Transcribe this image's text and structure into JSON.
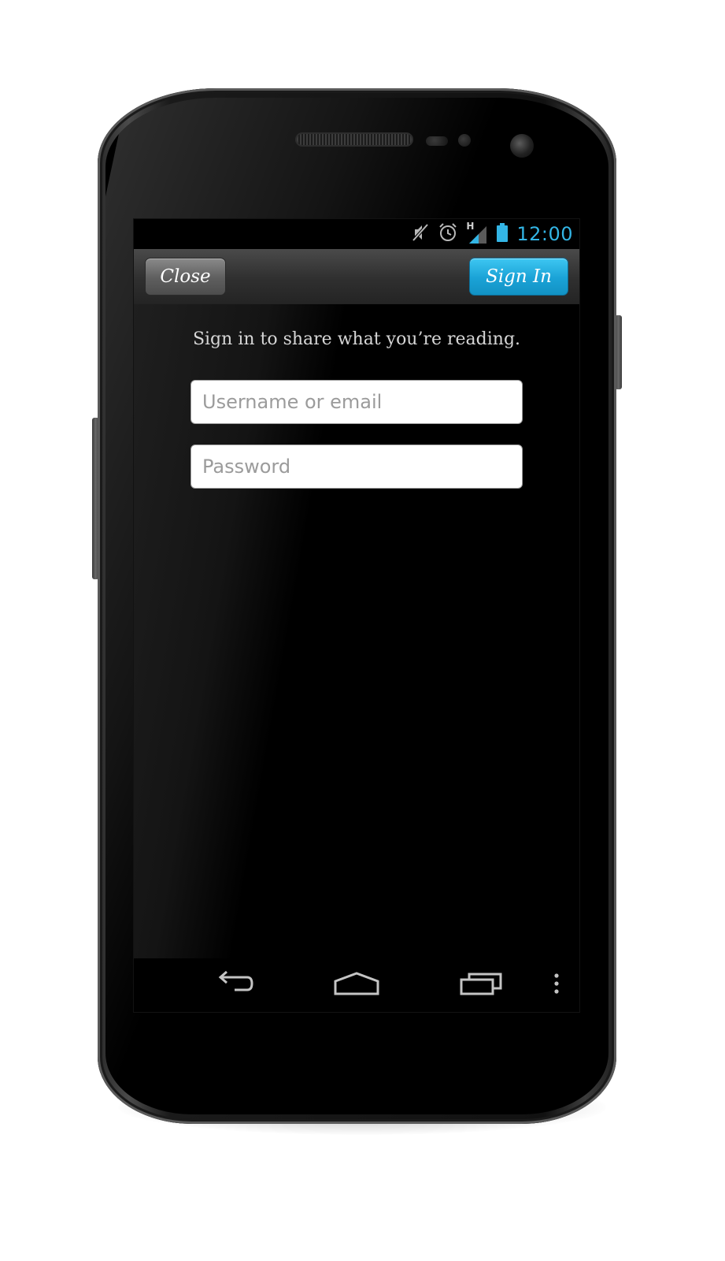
{
  "status_bar": {
    "time": "12:00",
    "network_type": "H",
    "icons": [
      "mute-icon",
      "alarm-icon",
      "signal-icon",
      "battery-icon"
    ],
    "accent_color": "#33b5e5"
  },
  "action_bar": {
    "close_label": "Close",
    "sign_in_label": "Sign In",
    "sign_in_color": "#1aa2d6"
  },
  "form": {
    "prompt": "Sign in to share what you’re reading.",
    "username_placeholder": "Username or email",
    "username_value": "",
    "password_placeholder": "Password",
    "password_value": ""
  },
  "nav_bar": {
    "icons": [
      "back-icon",
      "home-icon",
      "recent-apps-icon",
      "overflow-menu-icon"
    ]
  }
}
